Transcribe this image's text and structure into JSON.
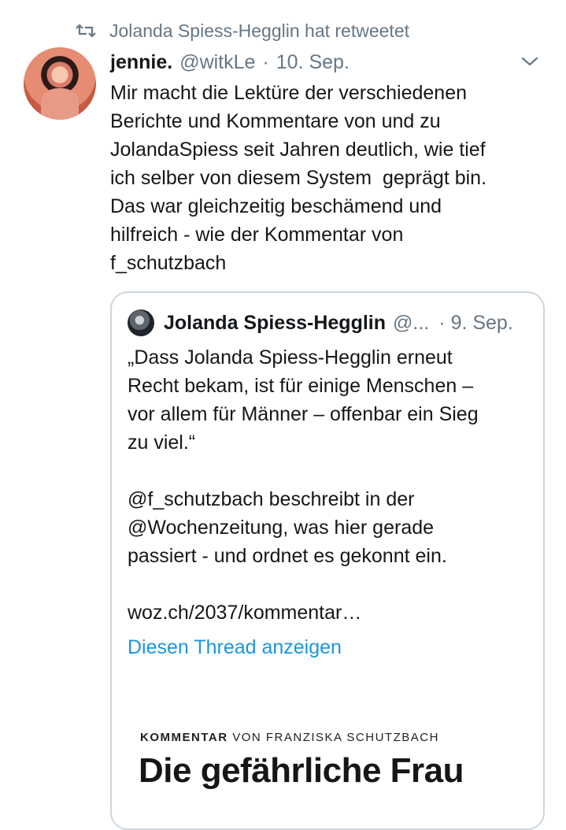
{
  "retweet": {
    "text": "Jolanda Spiess-Hegglin hat retweetet",
    "icon": "retweet-icon"
  },
  "tweet": {
    "author_name": "jennie.",
    "handle": "@witkLe",
    "separator": "·",
    "date": "10. Sep.",
    "menu_icon": "chevron-down-icon",
    "text": "Mir macht die Lektüre der verschiedenen\nBerichte und Kommentare von und zu\nJolandaSpiess seit Jahren deutlich, wie tief\nich selber von diesem System  geprägt bin.\nDas war gleichzeitig beschämend und\nhilfreich - wie der Kommentar von\nf_schutzbach"
  },
  "quote": {
    "author_name": "Jolanda Spiess-Hegglin",
    "handle": "@...",
    "separator": "·",
    "date": "9. Sep.",
    "text": "„Dass Jolanda Spiess-Hegglin erneut\nRecht bekam, ist für einige Menschen –\nvor allem für Männer – offenbar ein Sieg\nzu viel.“\n\n@f_schutzbach beschreibt in der\n@Wochenzeitung, was hier gerade\npassiert - und ordnet es gekonnt ein.\n\nwoz.ch/2037/kommentar…",
    "thread_link": "Diesen Thread anzeigen",
    "link_color": "#1b95e0"
  },
  "article": {
    "kicker_bold": "KOMMENTAR",
    "kicker_rest": " VON FRANZISKA SCHUTZBACH",
    "headline": "Die gefährliche Frau"
  }
}
